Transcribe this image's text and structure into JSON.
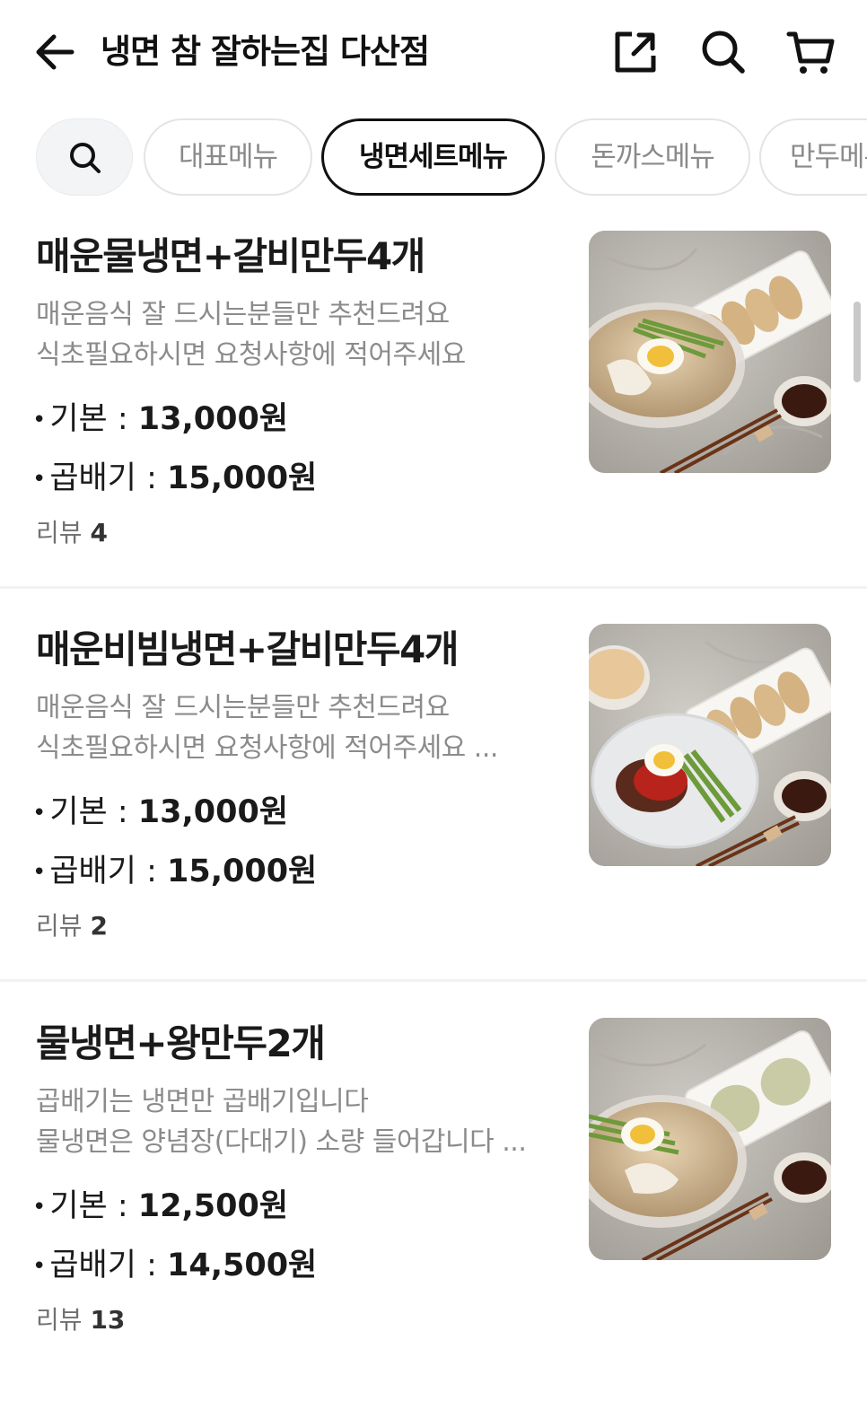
{
  "header": {
    "back_icon": "arrow-left-icon",
    "title": "냉면 참 잘하는집 다산점",
    "share_icon": "share-icon",
    "search_icon": "search-icon",
    "cart_icon": "cart-icon"
  },
  "categories": {
    "search_icon": "search-icon",
    "tabs": [
      {
        "label": "대표메뉴",
        "active": false
      },
      {
        "label": "냉면세트메뉴",
        "active": true
      },
      {
        "label": "돈까스메뉴",
        "active": false
      },
      {
        "label": "만두메뉴",
        "active": false
      }
    ]
  },
  "menu": [
    {
      "name": "매운물냉면+갈비만두4개",
      "desc_line1": "매운음식 잘 드시는분들만 추천드려요",
      "desc_line2": "식초필요하시면 요청사항에 적어주세요",
      "price_base_label": "기본 : ",
      "price_base": "13,000원",
      "price_double_label": "곱배기 : ",
      "price_double": "15,000원",
      "review_label": "리뷰",
      "review_count": "4"
    },
    {
      "name": "매운비빔냉면+갈비만두4개",
      "desc_line1": "매운음식 잘 드시는분들만 추천드려요",
      "desc_line2": "식초필요하시면 요청사항에 적어주세요 ...",
      "price_base_label": "기본 : ",
      "price_base": "13,000원",
      "price_double_label": "곱배기 : ",
      "price_double": "15,000원",
      "review_label": "리뷰",
      "review_count": "2"
    },
    {
      "name": "물냉면+왕만두2개",
      "desc_line1": "곱배기는 냉면만 곱배기입니다",
      "desc_line2": "물냉면은 양념장(다대기) 소량 들어갑니다 ...",
      "price_base_label": "기본 : ",
      "price_base": "12,500원",
      "price_double_label": "곱배기 : ",
      "price_double": "14,500원",
      "review_label": "리뷰",
      "review_count": "13"
    }
  ],
  "colors": {
    "text": "#1a1a1a",
    "muted": "#8b8b8b",
    "active_border": "#111111",
    "chip_border": "#e3e4e6"
  }
}
